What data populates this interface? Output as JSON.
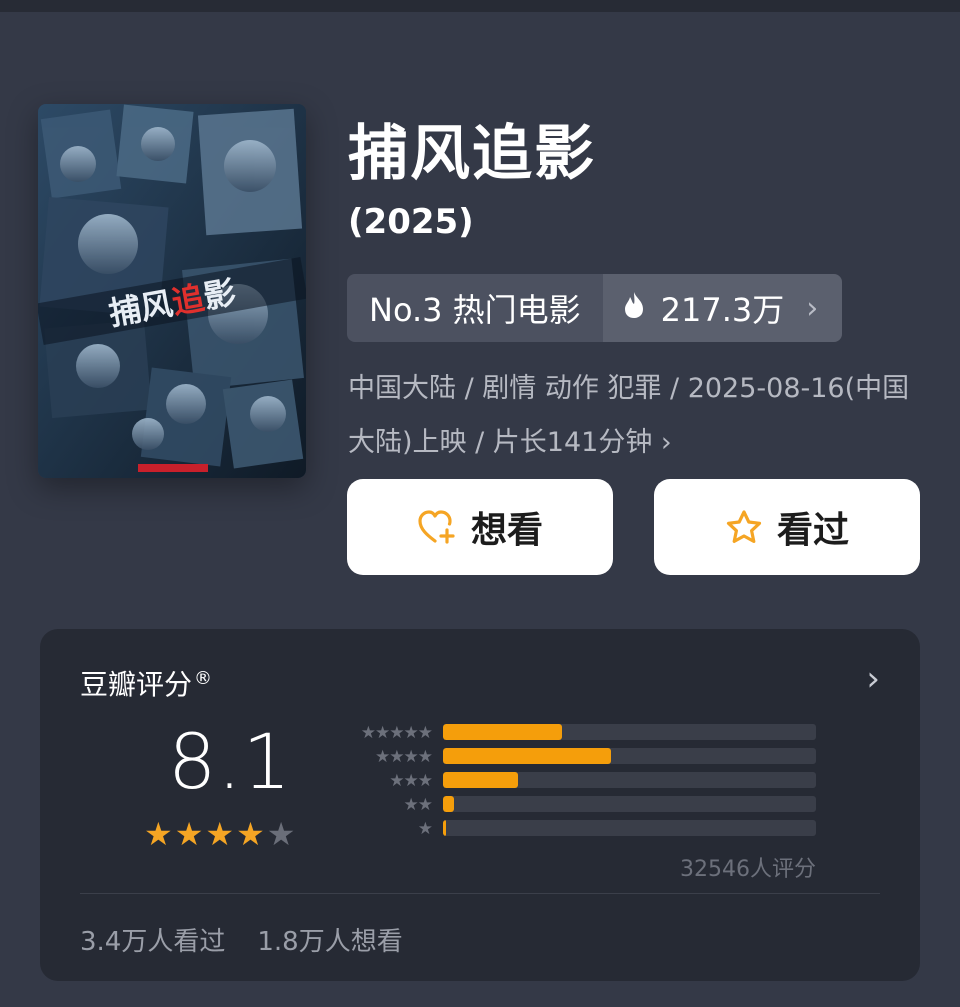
{
  "movie": {
    "title": "捕风追影",
    "year": "(2025)",
    "rank_label": "No.3 热门电影",
    "heat": "217.3万",
    "meta": "中国大陆 / 剧情 动作 犯罪 / 2025-08-16(中国大陆)上映 / 片长141分钟 ›",
    "want_label": "想看",
    "seen_label": "看过"
  },
  "rating": {
    "title": "豆瓣评分",
    "registered": "®",
    "score": "8.1",
    "stars_filled": 4,
    "stars_total": 5,
    "distribution": [
      {
        "stars": "★★★★★",
        "fraction": 0.32
      },
      {
        "stars": "★★★★",
        "fraction": 0.45
      },
      {
        "stars": "★★★",
        "fraction": 0.2
      },
      {
        "stars": "★★",
        "fraction": 0.03
      },
      {
        "stars": "★",
        "fraction": 0.008
      }
    ],
    "count": "32546人评分",
    "seen": "3.4万人看过",
    "want": "1.8万人想看"
  },
  "colors": {
    "background": "#343947",
    "card": "#262a34",
    "accent": "#f59e0b"
  },
  "icons": {
    "heat": "flame-icon",
    "want": "heart-plus-icon",
    "seen": "star-outline-icon",
    "chevron": "chevron-right-icon"
  }
}
